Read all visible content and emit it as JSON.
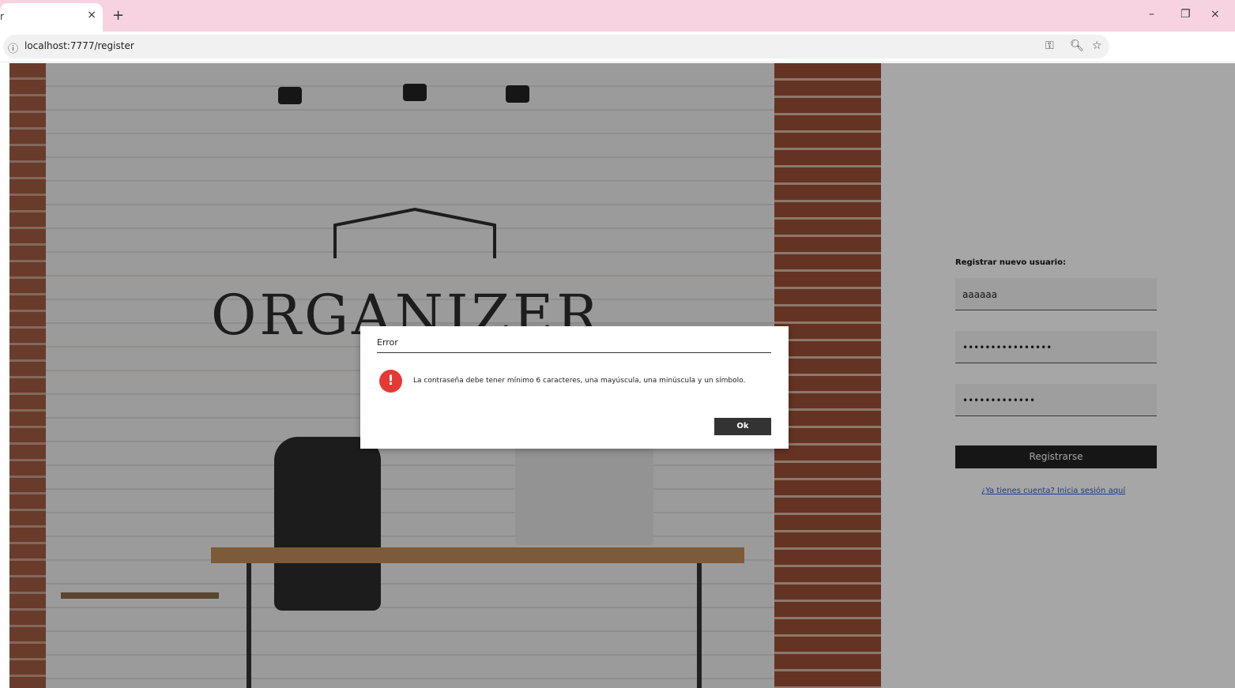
{
  "browser": {
    "tab_title": "r",
    "tab_close": "×",
    "new_tab": "+",
    "url": "localhost:7777/register",
    "window_controls": {
      "minimize": "–",
      "restore": "❐",
      "close": "×"
    }
  },
  "hero": {
    "logo_text": "ORGANIZER"
  },
  "form": {
    "title": "Registrar nuevo usuario:",
    "username_value": "aaaaaa",
    "password_value": "••••••••••••••••",
    "confirm_value": "•••••••••••••",
    "submit_label": "Registrarse",
    "login_link": "¿Ya tienes cuenta? Inicia sesión aquí"
  },
  "modal": {
    "title": "Error",
    "icon_glyph": "!",
    "message": "La contraseña debe tener mínimo 6 caracteres, una mayúscula, una minúscula y un símbolo.",
    "ok_label": "Ok"
  },
  "colors": {
    "tabbar": "#f7d3e2",
    "error_icon": "#e53935",
    "button": "#222222",
    "link": "#2a5bd7"
  }
}
